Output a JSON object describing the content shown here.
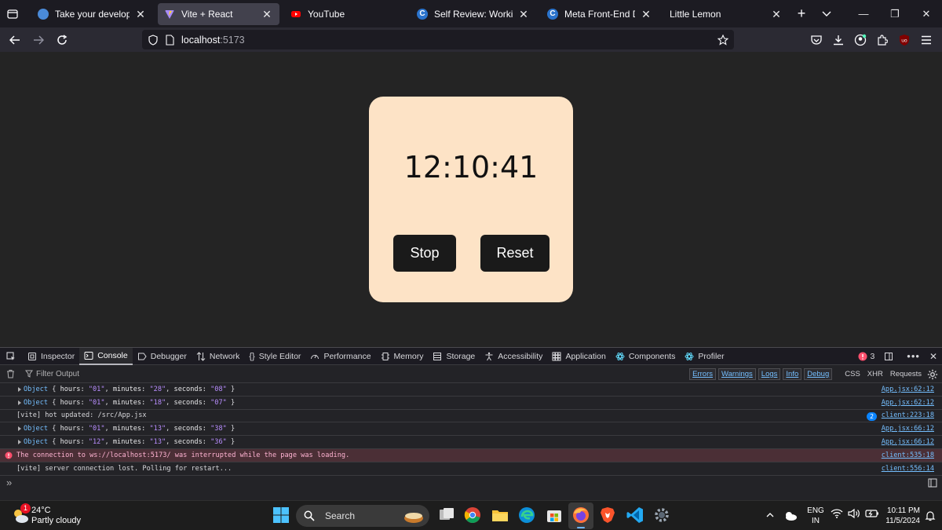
{
  "browser": {
    "tabs": [
      {
        "label": "Take your development skil",
        "icon": "coursera-globe-icon",
        "active": false,
        "closable": true
      },
      {
        "label": "Vite + React",
        "icon": "vite-icon",
        "active": true,
        "closable": true
      },
      {
        "label": "YouTube",
        "icon": "youtube-icon",
        "active": false,
        "closable": false
      },
      {
        "label": "Self Review: Working with E",
        "icon": "coursera-icon",
        "active": false,
        "closable": true
      },
      {
        "label": "Meta Front-End Developer |",
        "icon": "coursera-icon",
        "active": false,
        "closable": true
      },
      {
        "label": "Little Lemon",
        "icon": "",
        "active": false,
        "closable": true
      }
    ],
    "url": {
      "host": "localhost",
      "port": ":5173"
    }
  },
  "app": {
    "time": "12:10:41",
    "stop_label": "Stop",
    "reset_label": "Reset",
    "card_color": "#fde3c6"
  },
  "devtools": {
    "tabs": [
      "Inspector",
      "Console",
      "Debugger",
      "Network",
      "Style Editor",
      "Performance",
      "Memory",
      "Storage",
      "Accessibility",
      "Application",
      "Components",
      "Profiler"
    ],
    "active_tab": "Console",
    "error_count": "3",
    "filter_placeholder": "Filter Output",
    "filters": [
      "Errors",
      "Warnings",
      "Logs",
      "Info",
      "Debug"
    ],
    "extra_filters": [
      "CSS",
      "XHR",
      "Requests"
    ],
    "logs": [
      {
        "type": "object",
        "hours": "\"01\"",
        "minutes": "\"28\"",
        "seconds": "\"08\"",
        "source": "App.jsx:62:12"
      },
      {
        "type": "object",
        "hours": "\"01\"",
        "minutes": "\"18\"",
        "seconds": "\"07\"",
        "source": "App.jsx:62:12"
      },
      {
        "type": "text",
        "text": "[vite] hot updated: /src/App.jsx",
        "badge": "2",
        "source": "client:223:18"
      },
      {
        "type": "object",
        "hours": "\"01\"",
        "minutes": "\"13\"",
        "seconds": "\"38\"",
        "source": "App.jsx:66:12"
      },
      {
        "type": "object",
        "hours": "\"12\"",
        "minutes": "\"13\"",
        "seconds": "\"36\"",
        "source": "App.jsx:66:12"
      },
      {
        "type": "error",
        "text": "The connection to ws://localhost:5173/ was interrupted while the page was loading.",
        "source": "client:535:18"
      },
      {
        "type": "text",
        "text": "[vite] server connection lost. Polling for restart...",
        "source": "client:556:14"
      }
    ],
    "prompt": "»"
  },
  "taskbar": {
    "weather_temp": "24°C",
    "weather_desc": "Partly cloudy",
    "weather_badge": "1",
    "search_label": "Search",
    "lang_top": "ENG",
    "lang_bottom": "IN",
    "time": "10:11 PM",
    "date": "11/5/2024"
  }
}
